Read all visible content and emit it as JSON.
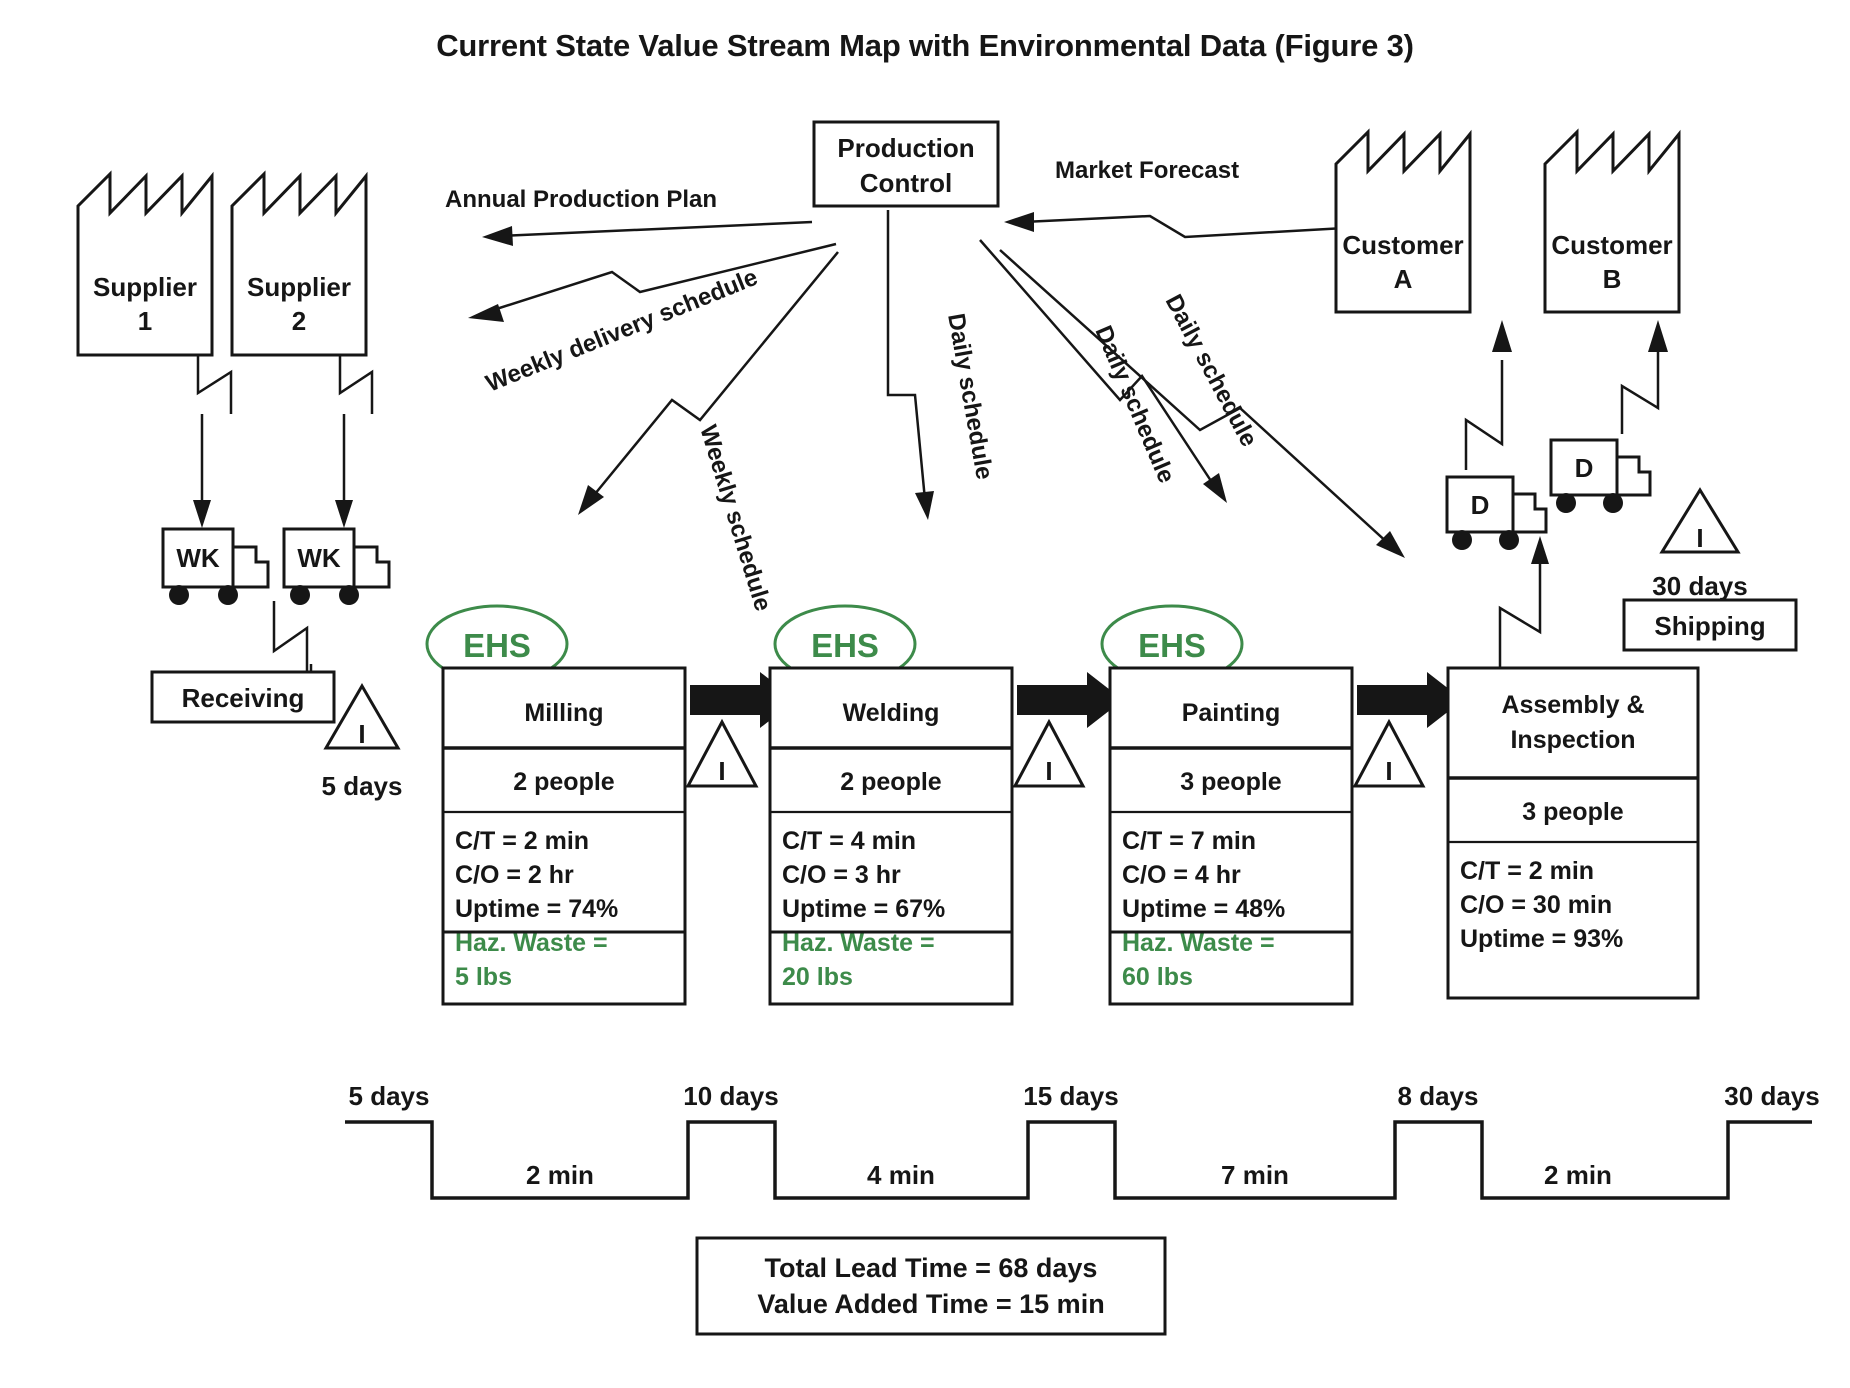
{
  "title": "Current State Value Stream Map with Environmental Data (Figure 3)",
  "colors": {
    "environmental_green": "#3d8b4a",
    "ink": "#161616",
    "background": "#ffffff"
  },
  "production_control": {
    "line1": "Production",
    "line2": "Control"
  },
  "suppliers": [
    {
      "line1": "Supplier",
      "line2": "1",
      "truck_label": "WK"
    },
    {
      "line1": "Supplier",
      "line2": "2",
      "truck_label": "WK"
    }
  ],
  "customers": [
    {
      "line1": "Customer",
      "line2": "A"
    },
    {
      "line1": "Customer",
      "line2": "B"
    }
  ],
  "receiving": {
    "label": "Receiving",
    "inventory_icon": "I",
    "days": "5 days"
  },
  "shipping": {
    "label": "Shipping",
    "inventory_icon": "I",
    "days": "30 days",
    "trucks": [
      {
        "label": "D"
      },
      {
        "label": "D"
      }
    ]
  },
  "information_flows": [
    {
      "name": "annual-production-plan",
      "label": "Annual Production Plan"
    },
    {
      "name": "market-forecast",
      "label": "Market Forecast"
    },
    {
      "name": "weekly-delivery-schedule",
      "label": "Weekly delivery schedule"
    },
    {
      "name": "weekly-schedule",
      "label": "Weekly schedule"
    },
    {
      "name": "daily-schedule-welding",
      "label": "Daily schedule"
    },
    {
      "name": "daily-schedule-painting",
      "label": "Daily schedule"
    },
    {
      "name": "daily-schedule-assembly",
      "label": "Daily schedule"
    }
  ],
  "processes": [
    {
      "name": "milling",
      "title": "Milling",
      "ehs_badge": "EHS",
      "people": "2 people",
      "metrics": [
        {
          "label": "C/T = 2 min",
          "env": false
        },
        {
          "label": "C/O = 2 hr",
          "env": false
        },
        {
          "label": "Uptime = 74%",
          "env": false
        },
        {
          "label": "Haz. Waste =",
          "env": true
        },
        {
          "label": "5 lbs",
          "env": true
        }
      ]
    },
    {
      "name": "welding",
      "title": "Welding",
      "ehs_badge": "EHS",
      "people": "2 people",
      "metrics": [
        {
          "label": "C/T = 4 min",
          "env": false
        },
        {
          "label": "C/O = 3 hr",
          "env": false
        },
        {
          "label": "Uptime = 67%",
          "env": false
        },
        {
          "label": "Haz. Waste =",
          "env": true
        },
        {
          "label": "20 lbs",
          "env": true
        }
      ]
    },
    {
      "name": "painting",
      "title": "Painting",
      "ehs_badge": "EHS",
      "people": "3 people",
      "metrics": [
        {
          "label": "C/T = 7 min",
          "env": false
        },
        {
          "label": "C/O = 4 hr",
          "env": false
        },
        {
          "label": "Uptime = 48%",
          "env": false
        },
        {
          "label": "Haz. Waste =",
          "env": true
        },
        {
          "label": "60 lbs",
          "env": true
        }
      ]
    },
    {
      "name": "assembly-inspection",
      "title_line1": "Assembly &",
      "title_line2": "Inspection",
      "ehs_badge": null,
      "people": "3 people",
      "metrics": [
        {
          "label": "C/T = 2 min",
          "env": false
        },
        {
          "label": "C/O = 30 min",
          "env": false
        },
        {
          "label": "Uptime = 93%",
          "env": false
        }
      ]
    }
  ],
  "inventory_triangles": [
    {
      "name": "inventory-receiving",
      "icon": "I"
    },
    {
      "name": "inventory-milling-welding",
      "icon": "I"
    },
    {
      "name": "inventory-welding-painting",
      "icon": "I"
    },
    {
      "name": "inventory-painting-assembly",
      "icon": "I"
    },
    {
      "name": "inventory-shipping",
      "icon": "I"
    }
  ],
  "timeline": {
    "lead_times": [
      "5 days",
      "10 days",
      "15 days",
      "8 days",
      "30 days"
    ],
    "value_added_times": [
      "2 min",
      "4 min",
      "7 min",
      "2 min"
    ]
  },
  "summary": {
    "lead_time": "Total Lead Time = 68 days",
    "value_added": "Value Added Time = 15 min"
  },
  "chart_data": {
    "type": "diagram",
    "title": "Current State Value Stream Map with Environmental Data (Figure 3)",
    "diagram_type": "value-stream-map",
    "processes": [
      "Milling",
      "Welding",
      "Painting",
      "Assembly & Inspection"
    ],
    "cycle_times_min": [
      2,
      4,
      7,
      2
    ],
    "changeover_times": [
      "2 hr",
      "3 hr",
      "4 hr",
      "30 min"
    ],
    "uptime_percent": [
      74,
      67,
      48,
      93
    ],
    "hazardous_waste_lbs": [
      5,
      20,
      60,
      null
    ],
    "people": [
      2,
      2,
      3,
      3
    ],
    "inventory_days": [
      5,
      10,
      15,
      8,
      30
    ],
    "total_lead_time_days": 68,
    "value_added_time_min": 15
  }
}
